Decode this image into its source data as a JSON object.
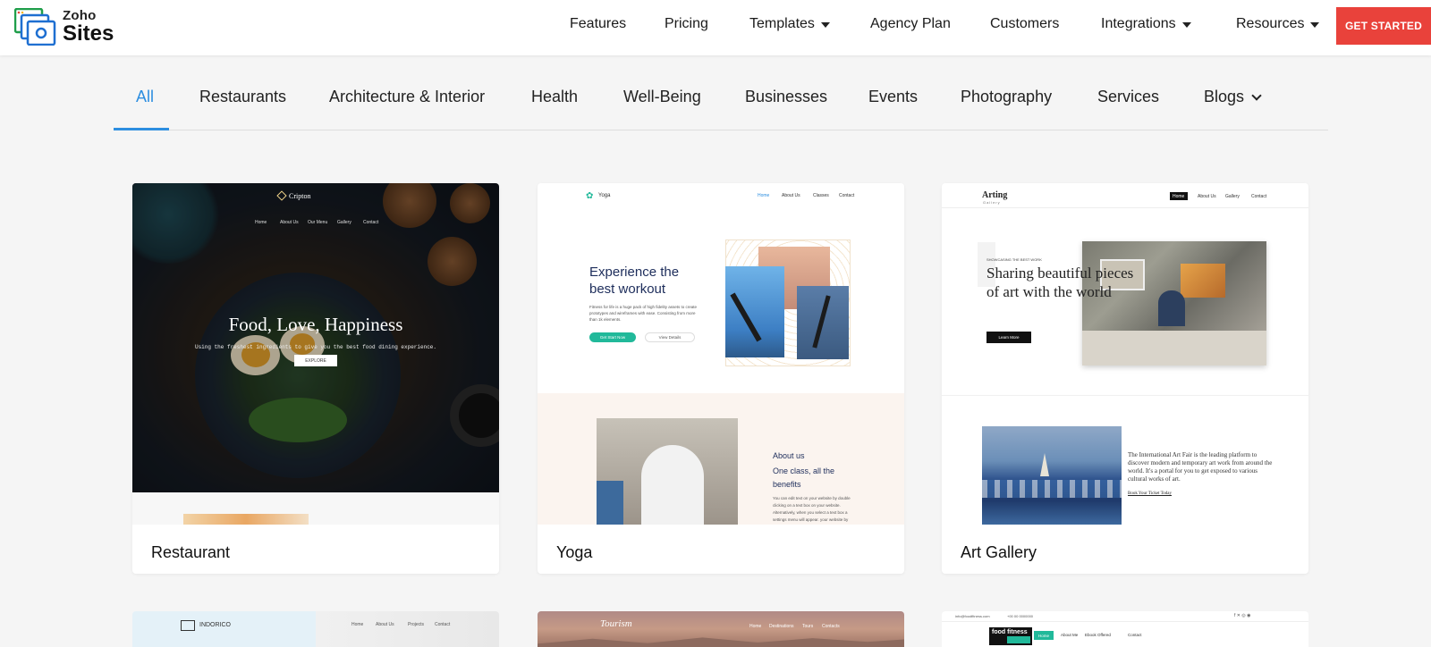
{
  "brand": {
    "line1": "Zoho",
    "line2": "Sites"
  },
  "nav": {
    "items": [
      {
        "label": "Features",
        "dropdown": false
      },
      {
        "label": "Pricing",
        "dropdown": false
      },
      {
        "label": "Templates",
        "dropdown": true
      },
      {
        "label": "Agency Plan",
        "dropdown": false
      },
      {
        "label": "Customers",
        "dropdown": false
      },
      {
        "label": "Integrations",
        "dropdown": true
      },
      {
        "label": "Resources",
        "dropdown": true
      }
    ],
    "cta": "GET STARTED"
  },
  "tabs": {
    "items": [
      {
        "label": "All"
      },
      {
        "label": "Restaurants"
      },
      {
        "label": "Architecture & Interior"
      },
      {
        "label": "Health"
      },
      {
        "label": "Well-Being"
      },
      {
        "label": "Businesses"
      },
      {
        "label": "Events"
      },
      {
        "label": "Photography"
      },
      {
        "label": "Services"
      },
      {
        "label": "Blogs"
      }
    ],
    "active": "All"
  },
  "cards": [
    {
      "label": "Restaurant",
      "preview": {
        "brand": "Cripton",
        "nav": [
          "Home",
          "About Us",
          "Our Menu",
          "Gallery",
          "Contact"
        ],
        "title": "Food, Love, Happiness",
        "subtitle": "Using the freshest ingredients to give you the best food dining experience.",
        "button": "EXPLORE"
      }
    },
    {
      "label": "Yoga",
      "preview": {
        "brand": "Yoga",
        "nav": [
          "Home",
          "About Us",
          "Classes",
          "Contact"
        ],
        "title": "Experience the best workout",
        "text": "Fitness for life is a huge pack of high fidelity assets to create prototypes and wireframes with ease. Consisting from more than 1k elements.",
        "button1": "Get Start Now",
        "button2": "View Details",
        "about_label": "About us",
        "about_title": "One class, all the benefits",
        "about_text": "You can edit text on your website by double clicking on a text box on your website. Alternatively, when you select a text box a settings menu will appear. your website by"
      }
    },
    {
      "label": "Art Gallery",
      "preview": {
        "brand": "Arting",
        "brand_sub": "Gallery",
        "nav": [
          "Home",
          "About Us",
          "Gallery",
          "Contact"
        ],
        "eyebrow": "SHOWCASING THE BEST WORK",
        "title": "Sharing beautiful pieces of art with the world",
        "button": "Learn More",
        "body": "The International Art Fair is the leading platform to discover modern and temporary art work from around the world. It's a portal for you to get exposed to various cultural works of art.",
        "link": "Book Your Ticket Today"
      }
    }
  ],
  "row2": [
    {
      "brand": "INDORICO",
      "nav": [
        "Home",
        "About Us",
        "Projects",
        "Contact"
      ]
    },
    {
      "brand": "Tourism",
      "nav": [
        "Home",
        "Destinations",
        "Tours",
        "Contacts"
      ]
    },
    {
      "brand": "food fitness",
      "email": "info@foodfitness.com",
      "phone": "+00 00 0000000",
      "nav": [
        "Home",
        "About Me",
        "Ebook Offered",
        "Contact"
      ]
    }
  ],
  "colors": {
    "accent": "#2d8ee0",
    "cta": "#e9423b",
    "yoga_green": "#21b99a"
  }
}
